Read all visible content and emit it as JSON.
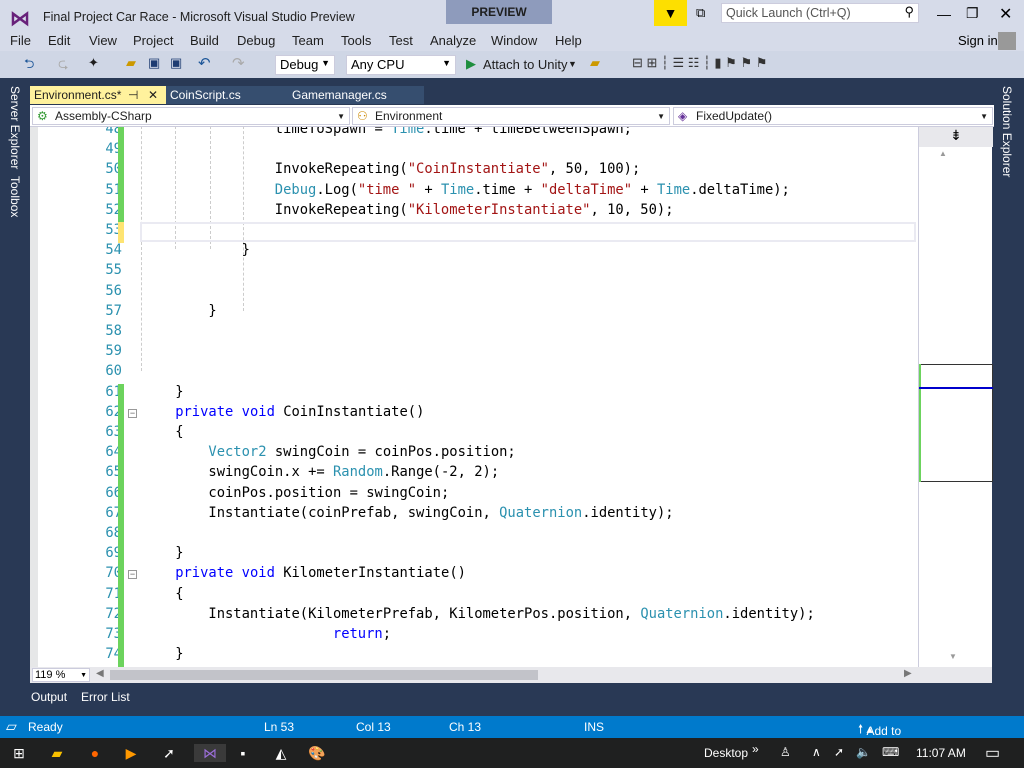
{
  "window": {
    "title": "Final Project Car Race - Microsoft Visual Studio Preview",
    "preview_badge": "PREVIEW",
    "quick_launch_placeholder": "Quick Launch (Ctrl+Q)",
    "sign_in": "Sign in"
  },
  "menu": [
    "File",
    "Edit",
    "View",
    "Project",
    "Build",
    "Debug",
    "Team",
    "Tools",
    "Test",
    "Analyze",
    "Window",
    "Help"
  ],
  "toolbar": {
    "config": "Debug",
    "platform": "Any CPU",
    "attach": "Attach to Unity"
  },
  "side_tabs": {
    "left": [
      "Server Explorer",
      "Toolbox"
    ],
    "right": "Solution Explorer"
  },
  "tabs": [
    {
      "label": "Environment.cs*",
      "active": true
    },
    {
      "label": "CoinScript.cs"
    },
    {
      "label": "Gamemanager.cs"
    }
  ],
  "nav": {
    "project": "Assembly-CSharp",
    "class": "Environment",
    "member": "FixedUpdate()"
  },
  "editor": {
    "zoom": "119 %",
    "first_line": 48,
    "lines": [
      [
        [
          16,
          ""
        ],
        [
          "timeToSpawn = "
        ],
        [
          "Time",
          "type"
        ],
        [
          ".time + timeBetweenSpawn;"
        ]
      ],
      [],
      [
        [
          16,
          ""
        ],
        [
          "InvokeRepeating("
        ],
        [
          "\"CoinInstantiate\"",
          "str"
        ],
        [
          ", 50, 100);"
        ]
      ],
      [
        [
          16,
          ""
        ],
        [
          "Debug",
          "type"
        ],
        [
          ".Log("
        ],
        [
          "\"time \"",
          "str"
        ],
        [
          " + "
        ],
        [
          "Time",
          "type"
        ],
        [
          ".time + "
        ],
        [
          "\"deltaTime\"",
          "str"
        ],
        [
          " + "
        ],
        [
          "Time",
          "type"
        ],
        [
          ".deltaTime);"
        ]
      ],
      [
        [
          16,
          ""
        ],
        [
          "InvokeRepeating("
        ],
        [
          "\"KilometerInstantiate\"",
          "str"
        ],
        [
          ", 10, 50);"
        ]
      ],
      [],
      [
        [
          12,
          ""
        ],
        [
          "}"
        ]
      ],
      [],
      [],
      [
        [
          8,
          ""
        ],
        [
          "}"
        ]
      ],
      [],
      [],
      [],
      [
        [
          4,
          ""
        ],
        [
          "}"
        ]
      ],
      [
        [
          4,
          ""
        ],
        [
          "private",
          "kw"
        ],
        [
          " "
        ],
        [
          "void",
          "kw"
        ],
        [
          " CoinInstantiate()"
        ]
      ],
      [
        [
          4,
          ""
        ],
        [
          "{"
        ]
      ],
      [
        [
          8,
          ""
        ],
        [
          "Vector2",
          "type"
        ],
        [
          " swingCoin = coinPos.position;"
        ]
      ],
      [
        [
          8,
          ""
        ],
        [
          "swingCoin.x += "
        ],
        [
          "Random",
          "type"
        ],
        [
          ".Range(-2, 2);"
        ]
      ],
      [
        [
          8,
          ""
        ],
        [
          "coinPos.position = swingCoin;"
        ]
      ],
      [
        [
          8,
          ""
        ],
        [
          "Instantiate(coinPrefab, swingCoin, "
        ],
        [
          "Quaternion",
          "type"
        ],
        [
          ".identity);"
        ]
      ],
      [],
      [
        [
          4,
          ""
        ],
        [
          "}"
        ]
      ],
      [
        [
          4,
          ""
        ],
        [
          "private",
          "kw"
        ],
        [
          " "
        ],
        [
          "void",
          "kw"
        ],
        [
          " KilometerInstantiate()"
        ]
      ],
      [
        [
          4,
          ""
        ],
        [
          "{"
        ]
      ],
      [
        [
          8,
          ""
        ],
        [
          "Instantiate(KilometerPrefab, KilometerPos.position, "
        ],
        [
          "Quaternion",
          "type"
        ],
        [
          ".identity);"
        ]
      ],
      [
        [
          23,
          ""
        ],
        [
          "return",
          "kw"
        ],
        [
          ";"
        ]
      ],
      [
        [
          4,
          ""
        ],
        [
          "}"
        ]
      ]
    ],
    "changes": {
      "green": [
        48,
        49,
        50,
        51,
        52,
        61,
        62,
        63,
        64,
        65,
        66,
        67,
        68,
        69,
        70,
        71,
        72,
        73,
        74
      ],
      "yellow": [
        53
      ]
    },
    "folds": [
      62,
      70
    ],
    "current_line": 53
  },
  "bottom_tabs": [
    "Output",
    "Error List"
  ],
  "status": {
    "state": "Ready",
    "ln": "Ln 53",
    "col": "Col 13",
    "ch": "Ch 13",
    "mode": "INS",
    "source_control": "Add to Source Control"
  },
  "taskbar": {
    "desktop": "Desktop",
    "time": "11:07 AM"
  },
  "colors": {
    "accent": "#007acc",
    "vs_purple": "#68217a",
    "active_tab": "#fff29d",
    "change_green": "#6cd35d",
    "change_yellow": "#fee472"
  }
}
